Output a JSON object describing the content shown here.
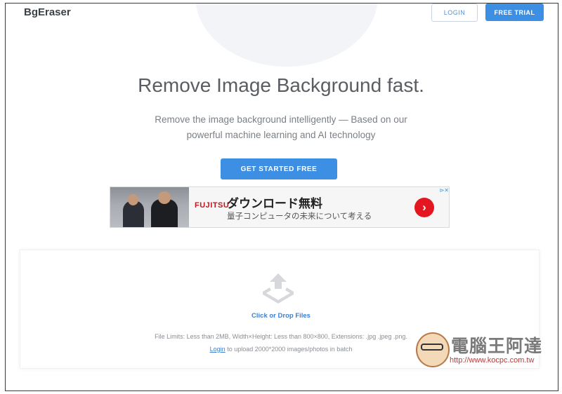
{
  "header": {
    "brand": "BgEraser",
    "login_label": "LOGIN",
    "trial_label": "FREE TRIAL"
  },
  "hero": {
    "title": "Remove Image Background fast.",
    "subtitle_line1": "Remove the image background intelligently — Based on our",
    "subtitle_line2": "powerful machine learning and AI technology",
    "cta_label": "GET STARTED FREE"
  },
  "ad": {
    "logo": "FUJITSU",
    "headline": "ダウンロード無料",
    "subline": "量子コンピュータの未来について考える",
    "arrow": "›",
    "choices": "⊳✕"
  },
  "upload": {
    "click_label": "Click or Drop Files",
    "limits": "File Limits: Less than 2MB, Width×Height: Less than 800×800, Extensions: .jpg .jpeg .png.",
    "login_link": "Login",
    "batch_text": " to upload 2000*2000 images/photos in batch"
  },
  "watermark": {
    "title": "電腦王阿達",
    "url": "http://www.kocpc.com.tw"
  },
  "colors": {
    "accent": "#3d8fe3",
    "ad_red": "#e4161f",
    "fujitsu_red": "#c4161c"
  }
}
